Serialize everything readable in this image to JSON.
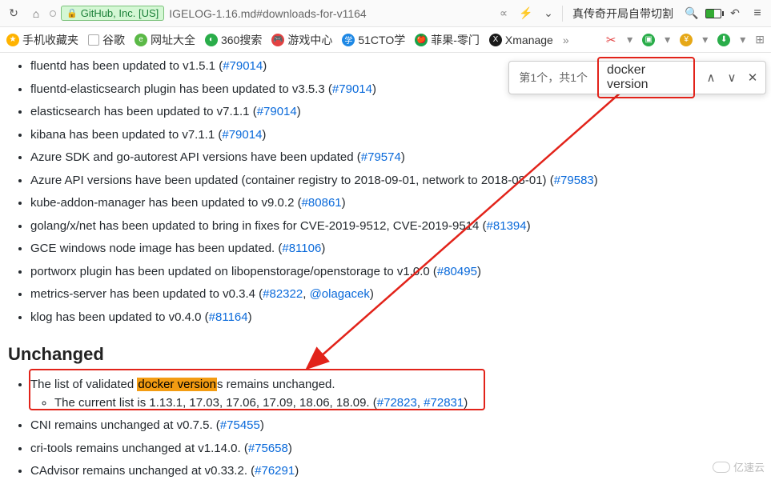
{
  "toolbar": {
    "site_identity": "GitHub, Inc. [US]",
    "url_suffix": "IGELOG-1.16.md#downloads-for-v1164",
    "tab_title": "真传奇开局自带切割"
  },
  "bookmarks": [
    {
      "label": "手机收藏夹",
      "color": "#ffb300"
    },
    {
      "label": "谷歌",
      "color": "#999"
    },
    {
      "label": "网址大全",
      "color": "#5bb947"
    },
    {
      "label": "360搜索",
      "color": "#2aad4a"
    },
    {
      "label": "游戏中心",
      "color": "#e34242"
    },
    {
      "label": "51CTO学",
      "color": "#1e88e5"
    },
    {
      "label": "菲果-零门",
      "color": "#1aa34a"
    },
    {
      "label": "Xmanage",
      "color": "#1a1a1a"
    }
  ],
  "find": {
    "count_text": "第1个，共1个",
    "query": "docker version"
  },
  "items": [
    {
      "text_before": "fluentd has been updated to v1.5.1 (",
      "link": "#79014",
      "text_after": ")"
    },
    {
      "text_before": "fluentd-elasticsearch plugin has been updated to v3.5.3 (",
      "link": "#79014",
      "text_after": ")"
    },
    {
      "text_before": "elasticsearch has been updated to v7.1.1 (",
      "link": "#79014",
      "text_after": ")"
    },
    {
      "text_before": "kibana has been updated to v7.1.1 (",
      "link": "#79014",
      "text_after": ")"
    },
    {
      "text_before": "Azure SDK and go-autorest API versions have been updated (",
      "link": "#79574",
      "text_after": ")"
    },
    {
      "text_before": "Azure API versions have been updated (container registry to 2018-09-01, network to 2018-08-01) (",
      "link": "#79583",
      "text_after": ")"
    },
    {
      "text_before": "kube-addon-manager has been updated to v9.0.2 (",
      "link": "#80861",
      "text_after": ")"
    },
    {
      "text_before": "golang/x/net has been updated to bring in fixes for CVE-2019-9512, CVE-2019-9514 (",
      "link": "#81394",
      "text_after": ")"
    },
    {
      "text_before": "GCE windows node image has been updated. (",
      "link": "#81106",
      "text_after": ")"
    },
    {
      "text_before": "portworx plugin has been updated on libopenstorage/openstorage to v1.0.0 (",
      "link": "#80495",
      "text_after": ")"
    }
  ],
  "metrics_item": {
    "text_a": "metrics-server has been updated to v0.3.4 (",
    "link_a": "#82322",
    "sep": ", ",
    "link_b": "@olagacek",
    "text_end": ")"
  },
  "klog_item": {
    "text_before": "klog has been updated to v0.4.0 (",
    "link": "#81164",
    "text_after": ")"
  },
  "section_heading": "Unchanged",
  "unchanged": {
    "docker_prefix": "The list of validated ",
    "docker_hl": "docker version",
    "docker_suffix": "s remains unchanged.",
    "sub_text": "The current list is 1.13.1, 17.03, 17.06, 17.09, 18.06, 18.09. (",
    "sub_l1": "#72823",
    "sub_sep": ", ",
    "sub_l2": "#72831",
    "sub_end": ")",
    "cni": {
      "text_before": "CNI remains unchanged at v0.7.5. (",
      "link": "#75455",
      "text_after": ")"
    },
    "cri": {
      "text_before": "cri-tools remains unchanged at v1.14.0. (",
      "link": "#75658",
      "text_after": ")"
    },
    "cad": {
      "text_before": "CAdvisor remains unchanged at v0.33.2. (",
      "link": "#76291",
      "text_after": ")"
    }
  },
  "watermark": "亿速云"
}
